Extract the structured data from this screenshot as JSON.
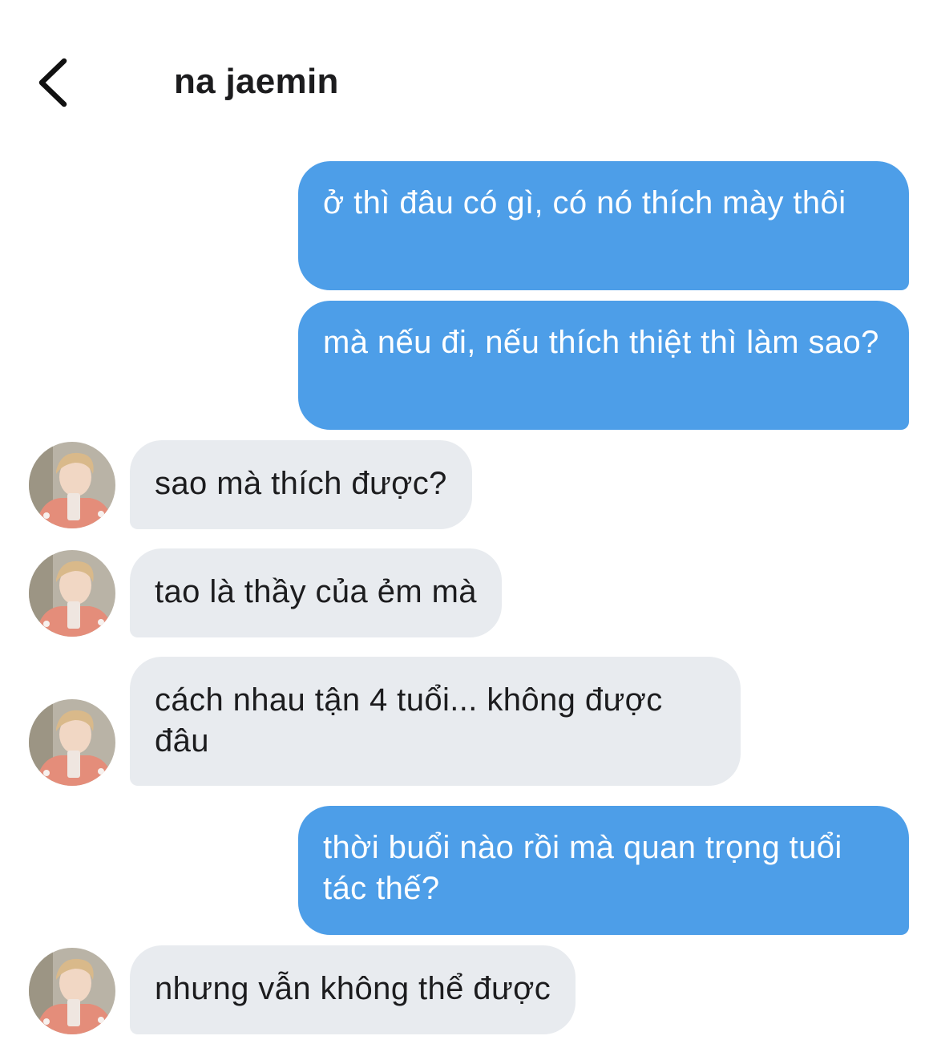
{
  "header": {
    "contact_name": "na jaemin",
    "back_icon": "chevron-left-icon"
  },
  "colors": {
    "outgoing_bubble": "#4d9ee8",
    "incoming_bubble": "#e8ebef",
    "text_dark": "#1c1c1e"
  },
  "messages": [
    {
      "from": "me",
      "text": "ở thì đâu có gì, có nó thích mày thôi"
    },
    {
      "from": "me",
      "text": "mà nếu đi, nếu thích thiệt thì làm sao?"
    },
    {
      "from": "contact",
      "text": "sao mà thích được?"
    },
    {
      "from": "contact",
      "text": "tao là thầy của ẻm mà"
    },
    {
      "from": "contact",
      "text": "cách nhau tận 4 tuổi... không được đâu"
    },
    {
      "from": "me",
      "text": "thời buổi nào rồi mà quan trọng tuổi tác thế?"
    },
    {
      "from": "contact",
      "text": "nhưng vẫn không thể được"
    }
  ]
}
